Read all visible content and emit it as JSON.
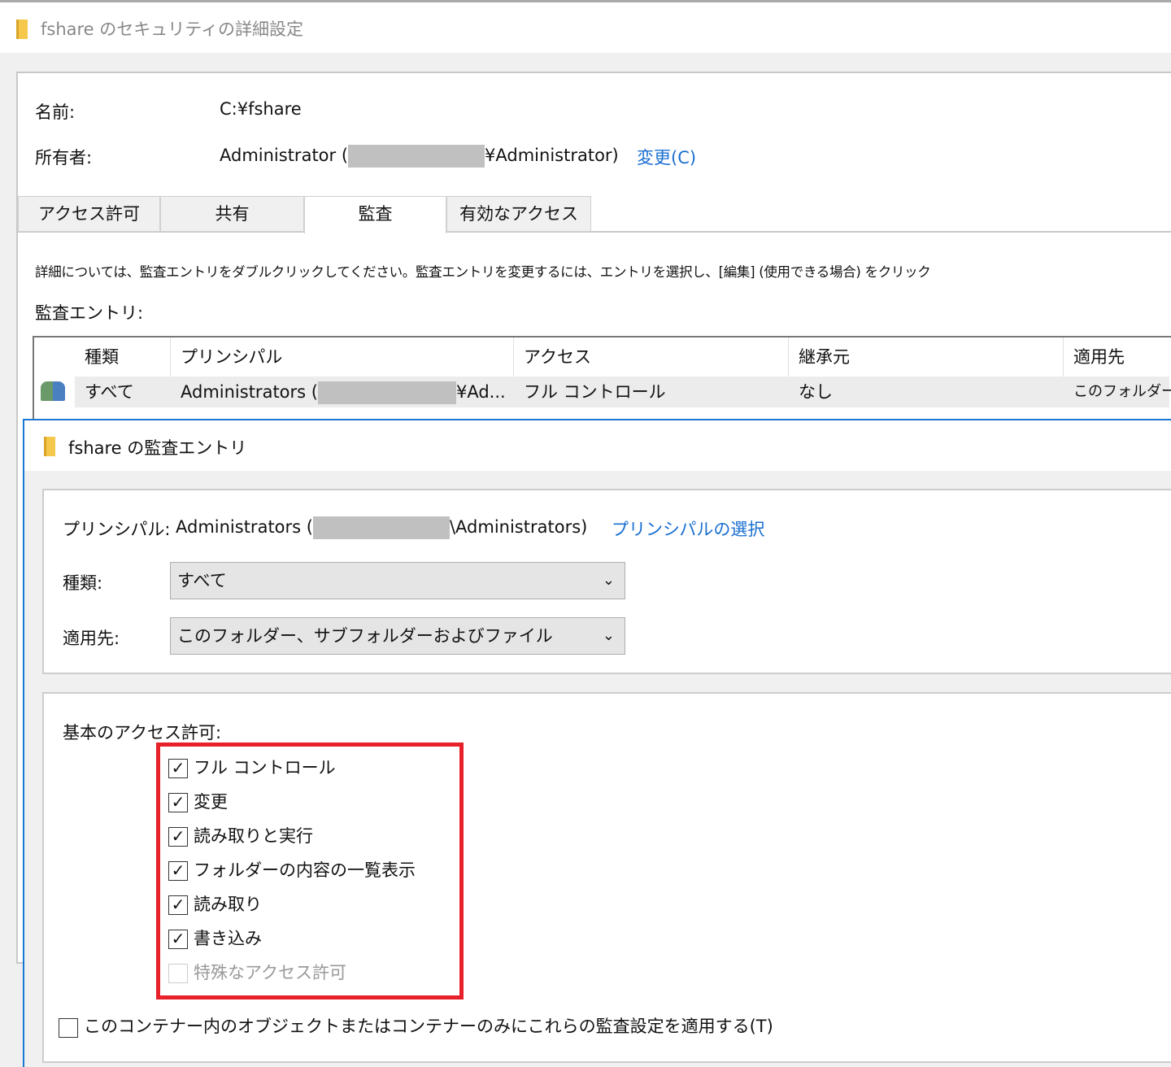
{
  "back_window": {
    "title": "fshare のセキュリティの詳細設定",
    "name_label": "名前:",
    "name_value": "C:¥fshare",
    "owner_label": "所有者:",
    "owner_prefix": "Administrator (",
    "owner_suffix": "¥Administrator)",
    "change_link": "変更(C)",
    "tabs": [
      "アクセス許可",
      "共有",
      "監査",
      "有効なアクセス"
    ],
    "info_text": "詳細については、監査エントリをダブルクリックしてください。監査エントリを変更するには、エントリを選択し、[編集] (使用できる場合) をクリック",
    "entries_label": "監査エントリ:",
    "columns": [
      "種類",
      "プリンシパル",
      "アクセス",
      "継承元",
      "適用先"
    ],
    "row": {
      "type": "すべて",
      "principal_prefix": "Administrators (",
      "principal_suffix": "¥Ad...",
      "access": "フル コントロール",
      "inherited": "なし",
      "applies": "このフォルダー"
    }
  },
  "dialog": {
    "title": "fshare の監査エントリ",
    "principal_label": "プリンシパル:",
    "principal_prefix": "Administrators (",
    "principal_suffix": "\\Administrators)",
    "select_principal": "プリンシパルの選択",
    "type_label": "種類:",
    "type_value": "すべて",
    "applies_label": "適用先:",
    "applies_value": "このフォルダー、サブフォルダーおよびファイル",
    "basic_label": "基本のアクセス許可:",
    "permissions": [
      {
        "label": "フル コントロール",
        "checked": true
      },
      {
        "label": "変更",
        "checked": true
      },
      {
        "label": "読み取りと実行",
        "checked": true
      },
      {
        "label": "フォルダーの内容の一覧表示",
        "checked": true
      },
      {
        "label": "読み取り",
        "checked": true
      },
      {
        "label": "書き込み",
        "checked": true
      },
      {
        "label": "特殊なアクセス許可",
        "checked": false,
        "disabled": true
      }
    ],
    "container_only": "このコンテナー内のオブジェクトまたはコンテナーのみにこれらの監査設定を適用する(T)",
    "highlight_color": "#e8202a"
  }
}
